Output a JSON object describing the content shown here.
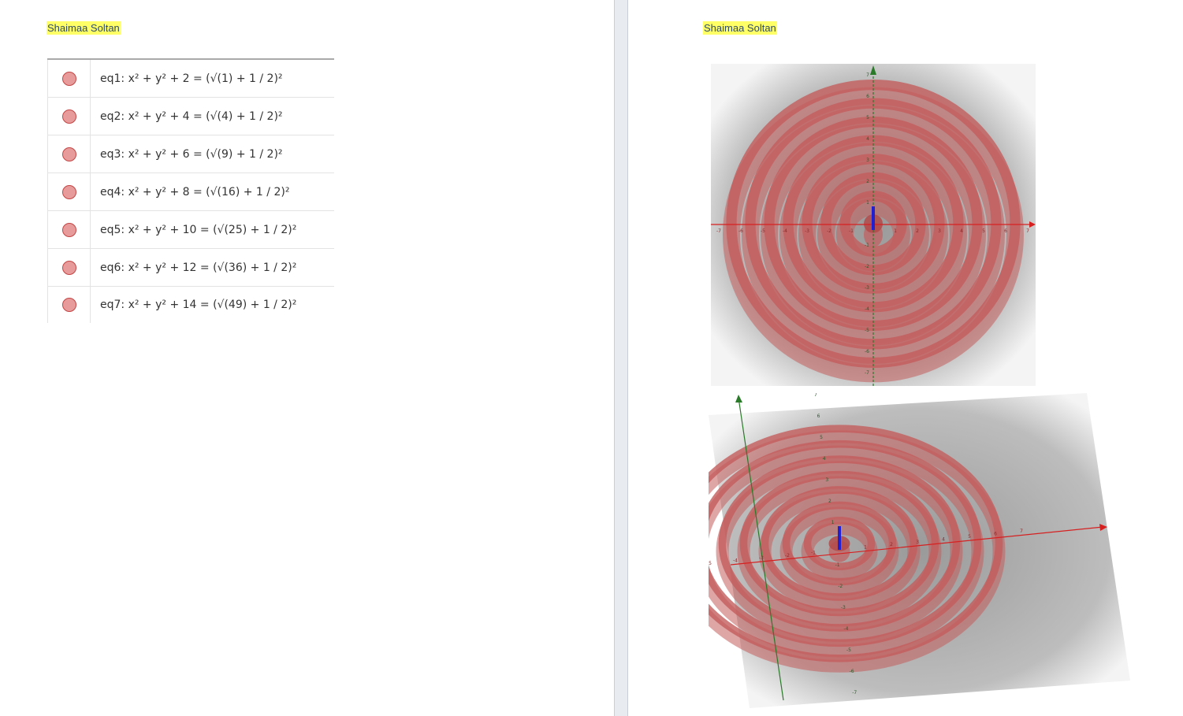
{
  "author_left": "Shaimaa Soltan",
  "author_right": "Shaimaa Soltan",
  "equations": [
    {
      "label": "eq1: x² + y² + 2 = (√(1) + 1 / 2)²"
    },
    {
      "label": "eq2: x² + y² + 4 = (√(4) + 1 / 2)²"
    },
    {
      "label": "eq3: x² + y² + 6 = (√(9) + 1 / 2)²"
    },
    {
      "label": "eq4: x² + y² + 8 = (√(16) + 1 / 2)²"
    },
    {
      "label": "eq5: x² + y² + 10 = (√(25) + 1 / 2)²"
    },
    {
      "label": "eq6: x² + y² + 12 = (√(36) + 1 / 2)²"
    },
    {
      "label": "eq7: x² + y² + 14 = (√(49) + 1 / 2)²"
    }
  ],
  "colors": {
    "surface": "#c45c5c",
    "marble_fill": "#e89b9b",
    "marble_border": "#c44545",
    "x_axis": "#d62020",
    "y_axis": "#2a7a2a",
    "z_axis": "#2020d0",
    "highlight": "#ffff66"
  },
  "views": {
    "top_view": {
      "x_ticks": [
        "-7",
        "-6",
        "-5",
        "-4",
        "-3",
        "-2",
        "-1",
        "1",
        "2",
        "3",
        "4",
        "5",
        "6",
        "7"
      ],
      "y_ticks": [
        "7",
        "6",
        "5",
        "4",
        "3",
        "2",
        "1",
        "-1",
        "-2",
        "-3",
        "-4",
        "-5",
        "-6",
        "-7"
      ]
    },
    "tilted_view": {
      "x_ticks": [
        "-7",
        "-6",
        "-5",
        "-4",
        "-3",
        "-2",
        "-1",
        "1",
        "2",
        "3",
        "4",
        "5",
        "6",
        "7"
      ],
      "y_ticks": [
        "7",
        "6",
        "5",
        "4",
        "3",
        "2",
        "1",
        "-1",
        "-2",
        "-3",
        "-4",
        "-5",
        "-6",
        "-7"
      ]
    }
  }
}
